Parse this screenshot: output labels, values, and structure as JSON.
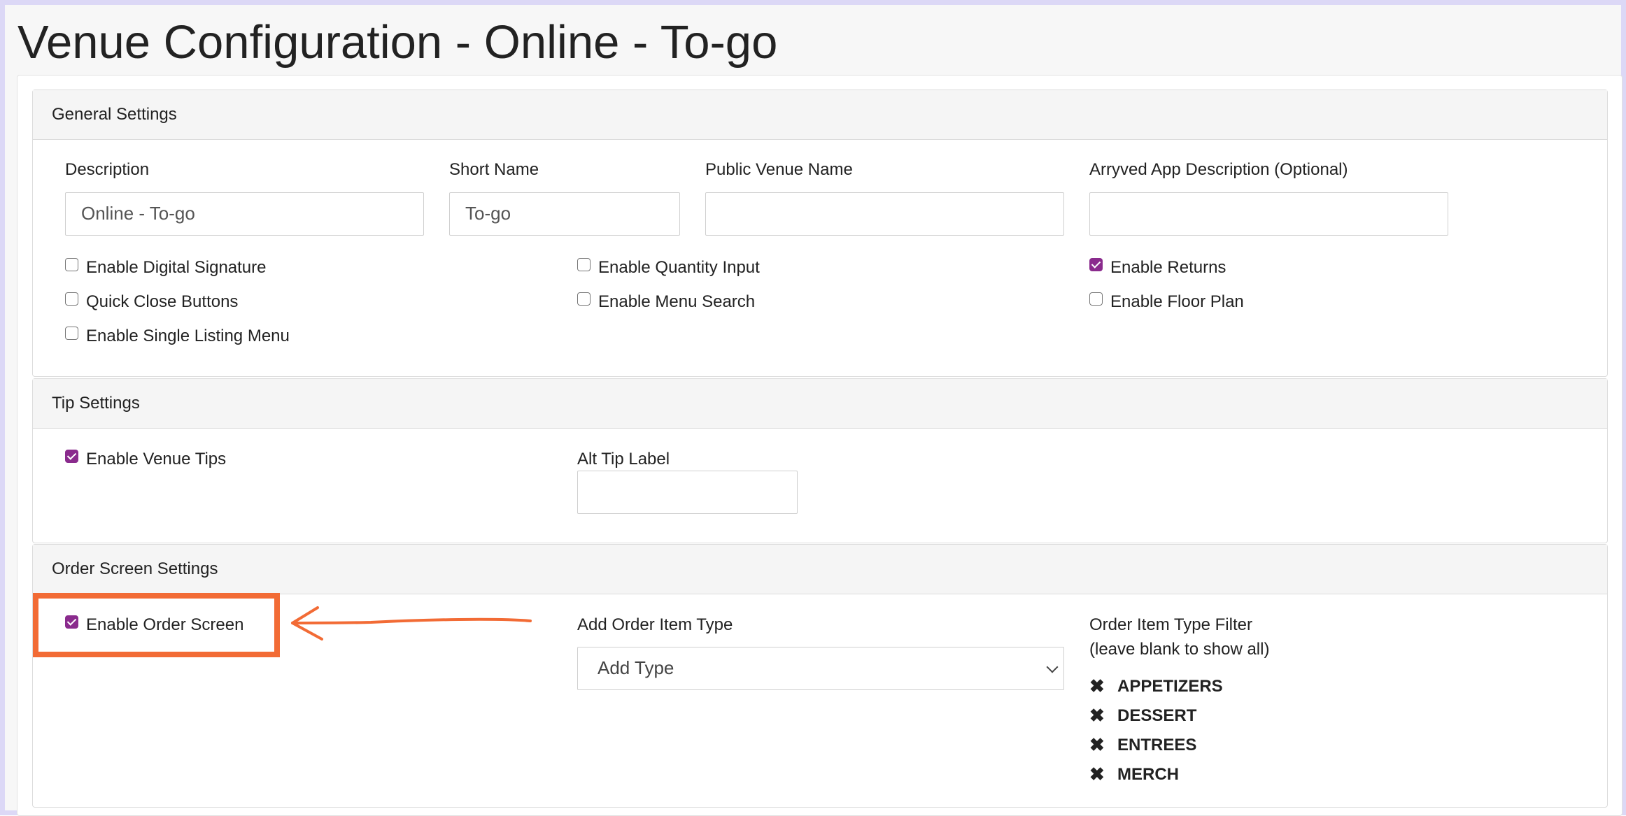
{
  "page": {
    "title": "Venue Configuration - Online - To-go"
  },
  "general": {
    "title": "General Settings",
    "description": {
      "label": "Description",
      "value": "Online - To-go"
    },
    "short_name": {
      "label": "Short Name",
      "value": "To-go"
    },
    "public_venue_name": {
      "label": "Public Venue Name",
      "value": ""
    },
    "app_description": {
      "label": "Arryved App Description (Optional)",
      "value": ""
    },
    "checkboxes": {
      "digital_signature": {
        "label": "Enable Digital Signature",
        "checked": false
      },
      "quick_close": {
        "label": "Quick Close Buttons",
        "checked": false
      },
      "single_listing": {
        "label": "Enable Single Listing Menu",
        "checked": false
      },
      "quantity_input": {
        "label": "Enable Quantity Input",
        "checked": false
      },
      "menu_search": {
        "label": "Enable Menu Search",
        "checked": false
      },
      "returns": {
        "label": "Enable Returns",
        "checked": true
      },
      "floor_plan": {
        "label": "Enable Floor Plan",
        "checked": false
      }
    }
  },
  "tips": {
    "title": "Tip Settings",
    "venue_tips": {
      "label": "Enable Venue Tips",
      "checked": true
    },
    "alt_tip_label": {
      "label": "Alt Tip Label",
      "value": ""
    }
  },
  "order_screen": {
    "title": "Order Screen Settings",
    "enable": {
      "label": "Enable Order Screen",
      "checked": true
    },
    "add_type": {
      "label": "Add Order Item Type",
      "selected": "Add Type"
    },
    "filter": {
      "label_line1": "Order Item Type Filter",
      "label_line2": "(leave blank to show all)",
      "items": [
        "APPETIZERS",
        "DESSERT",
        "ENTREES",
        "MERCH"
      ]
    }
  },
  "colors": {
    "accent": "#8a2b8d",
    "annotation": "#f26b35",
    "frame": "#dcd8f6"
  },
  "icons": {
    "remove": "close-x-icon",
    "annotation_arrow": "arrow-left-icon"
  }
}
